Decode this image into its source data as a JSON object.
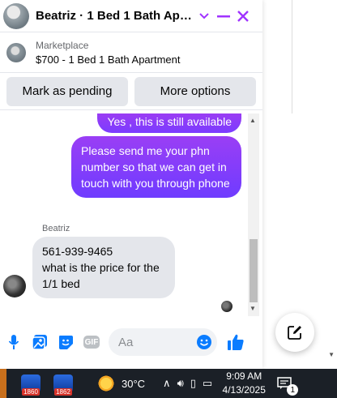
{
  "chat": {
    "title": "Beatriz · 1 Bed 1 Bath Apartment",
    "listing": {
      "source": "Marketplace",
      "summary": "$700 - 1 Bed 1 Bath Apartment"
    },
    "actions": {
      "mark_pending": "Mark as pending",
      "more_options": "More options"
    },
    "messages": [
      {
        "from": "me",
        "text": "Yes , this is still available"
      },
      {
        "from": "me",
        "text": "Please send me your phn number so that we can get in touch with you through phone"
      },
      {
        "from": "Beatriz",
        "sender_label": "Beatriz",
        "lines": [
          "561-939-9465",
          "what is the price for the 1/1 bed"
        ]
      }
    ],
    "composer": {
      "placeholder": "Aa",
      "gif_label": "GIF"
    }
  },
  "taskbar": {
    "apps": [
      {
        "badge": "1860"
      },
      {
        "badge": "1862"
      }
    ],
    "weather": "30°C",
    "clock_time": "9:09 AM",
    "clock_date": "4/13/2025",
    "notification_count": "1"
  },
  "colors": {
    "messenger_purple": "#a033ff",
    "bubble_gradient_start": "#a23cf0",
    "bubble_gradient_end": "#6f3cff",
    "incoming_bubble": "#e4e6eb",
    "accent_blue": "#0a7cff"
  }
}
